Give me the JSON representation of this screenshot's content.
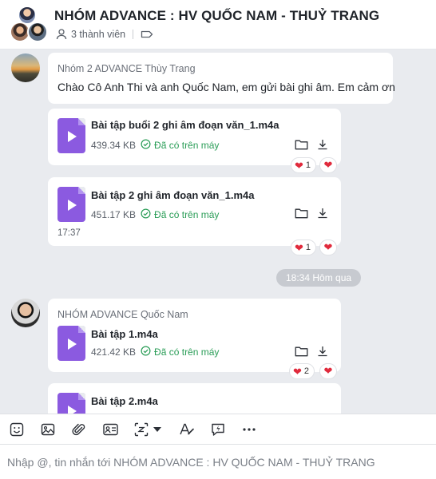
{
  "header": {
    "title": "NHÓM ADVANCE : HV QUỐC NAM - THUỶ TRANG",
    "member_count": "3 thành viên"
  },
  "messages": {
    "msg1": {
      "sender": "Nhóm 2 ADVANCE Thùy Trang",
      "text": "Chào Cô Anh Thi và anh Quốc Nam, em gửi bài ghi âm. Em cảm ơn"
    },
    "file1": {
      "name": "Bài tập buổi 2 ghi âm đoạn văn_1.m4a",
      "size": "439.34 KB",
      "status": "Đã có trên máy",
      "reaction_count": "1"
    },
    "file2": {
      "name": "Bài tập 2 ghi âm đoạn văn_1.m4a",
      "size": "451.17 KB",
      "status": "Đã có trên máy",
      "time": "17:37",
      "reaction_count": "1"
    },
    "divider": "18:34 Hôm qua",
    "msg2": {
      "sender": "NHÓM ADVANCE  Quốc Nam"
    },
    "file3": {
      "name": "Bài tập 1.m4a",
      "size": "421.42 KB",
      "status": "Đã có trên máy",
      "reaction_count": "2"
    },
    "file4": {
      "name": "Bài tập 2.m4a"
    }
  },
  "input": {
    "placeholder": "Nhập @, tin nhắn tới NHÓM ADVANCE : HV QUỐC NAM - THUỶ TRANG"
  },
  "colors": {
    "chat_background": "#e9ebef",
    "file_icon": "#8b5ae0",
    "status_green": "#2a9d57",
    "heart": "#e02a3c"
  },
  "icons": [
    "group-avatar",
    "member-icon",
    "tag-icon",
    "folder-icon",
    "download-icon",
    "check-circle-icon",
    "heart-icon",
    "sticker-icon",
    "image-icon",
    "attachment-icon",
    "contact-card-icon",
    "screenshot-icon",
    "format-text-icon",
    "quick-message-icon",
    "more-icon"
  ]
}
